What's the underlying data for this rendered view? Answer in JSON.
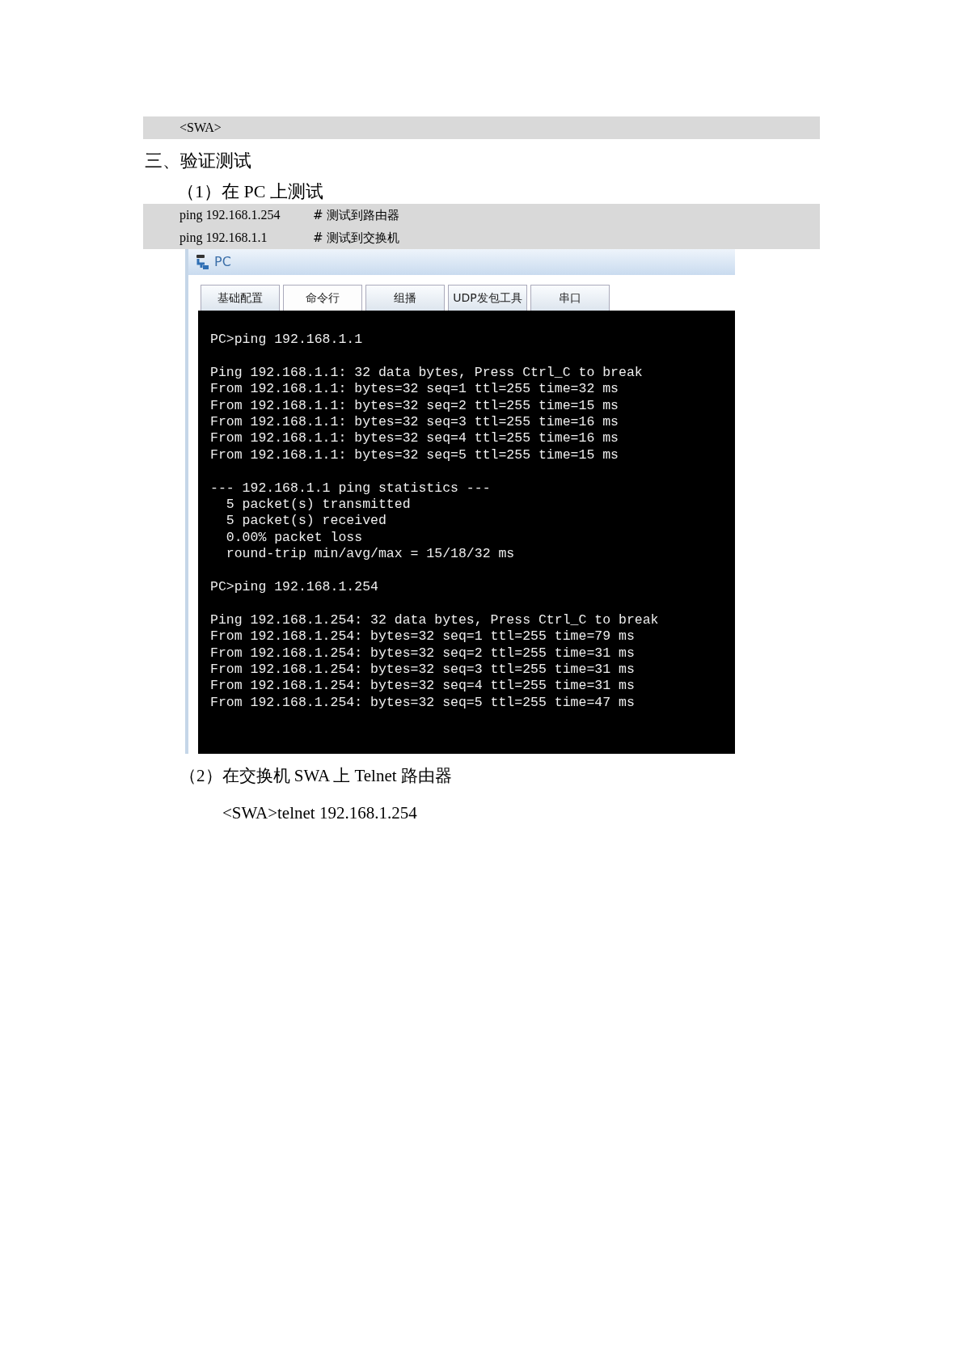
{
  "prompt_block": {
    "text": "<SWA>"
  },
  "section_heading": "三、验证测试",
  "step_1": "（1）在 PC  上测试",
  "commands": [
    {
      "command": "ping 192.168.1.254",
      "comment": "#  测试到路由器"
    },
    {
      "command": "ping 192.168.1.1",
      "comment": "#  测试到交换机"
    }
  ],
  "window": {
    "title": "PC",
    "tabs": [
      {
        "label": "基础配置",
        "selected": false
      },
      {
        "label": "命令行",
        "selected": true
      },
      {
        "label": "组播",
        "selected": false
      },
      {
        "label": "UDP发包工具",
        "selected": false
      },
      {
        "label": "串口",
        "selected": false
      }
    ],
    "terminal_groups": [
      [
        "PC>ping 192.168.1.1"
      ],
      [
        "Ping 192.168.1.1: 32 data bytes, Press Ctrl_C to break",
        "From 192.168.1.1: bytes=32 seq=1 ttl=255 time=32 ms",
        "From 192.168.1.1: bytes=32 seq=2 ttl=255 time=15 ms",
        "From 192.168.1.1: bytes=32 seq=3 ttl=255 time=16 ms",
        "From 192.168.1.1: bytes=32 seq=4 ttl=255 time=16 ms",
        "From 192.168.1.1: bytes=32 seq=5 ttl=255 time=15 ms"
      ],
      [
        "--- 192.168.1.1 ping statistics ---",
        "  5 packet(s) transmitted",
        "  5 packet(s) received",
        "  0.00% packet loss",
        "  round-trip min/avg/max = 15/18/32 ms"
      ],
      [
        "PC>ping 192.168.1.254"
      ],
      [
        "Ping 192.168.1.254: 32 data bytes, Press Ctrl_C to break",
        "From 192.168.1.254: bytes=32 seq=1 ttl=255 time=79 ms",
        "From 192.168.1.254: bytes=32 seq=2 ttl=255 time=31 ms",
        "From 192.168.1.254: bytes=32 seq=3 ttl=255 time=31 ms",
        "From 192.168.1.254: bytes=32 seq=4 ttl=255 time=31 ms",
        "From 192.168.1.254: bytes=32 seq=5 ttl=255 time=47 ms"
      ]
    ]
  },
  "step_2": "（2）在交换机 SWA 上 Telnet 路由器",
  "telnet_command": "<SWA>telnet 192.168.1.254"
}
